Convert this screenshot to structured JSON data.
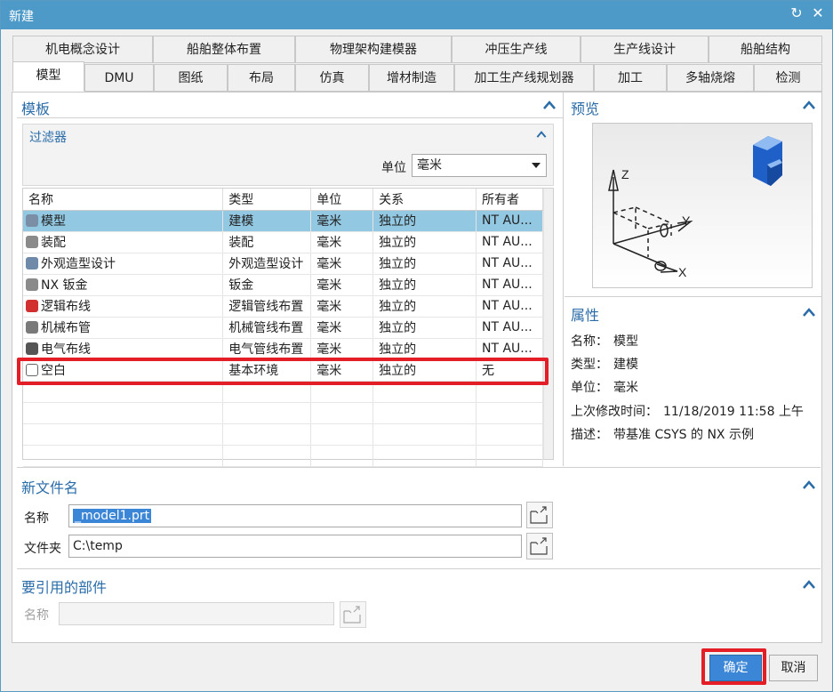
{
  "window": {
    "title": "新建",
    "refresh_glyph": "↻",
    "close_glyph": "✕"
  },
  "tabs_row1": [
    "机电概念设计",
    "船舶整体布置",
    "物理架构建模器",
    "冲压生产线",
    "生产线设计",
    "船舶结构"
  ],
  "tabs_row2": [
    "模型",
    "DMU",
    "图纸",
    "布局",
    "仿真",
    "增材制造",
    "加工生产线规划器",
    "加工",
    "多轴烧熔",
    "检测"
  ],
  "template": {
    "title": "模板",
    "filter": {
      "title": "过滤器",
      "unit_label": "单位",
      "unit_value": "毫米"
    },
    "columns": [
      "名称",
      "类型",
      "单位",
      "关系",
      "所有者"
    ],
    "rows": [
      {
        "name": "模型",
        "type": "建模",
        "unit": "毫米",
        "relation": "独立的",
        "owner": "NT AU...",
        "icon": "model-icon",
        "selected": true
      },
      {
        "name": "装配",
        "type": "装配",
        "unit": "毫米",
        "relation": "独立的",
        "owner": "NT AU...",
        "icon": "assembly-icon"
      },
      {
        "name": "外观造型设计",
        "type": "外观造型设计",
        "unit": "毫米",
        "relation": "独立的",
        "owner": "NT AU...",
        "icon": "shape-design-icon"
      },
      {
        "name": "NX 钣金",
        "type": "钣金",
        "unit": "毫米",
        "relation": "独立的",
        "owner": "NT AU...",
        "icon": "sheet-metal-icon"
      },
      {
        "name": "逻辑布线",
        "type": "逻辑管线布置",
        "unit": "毫米",
        "relation": "独立的",
        "owner": "NT AU...",
        "icon": "logic-routing-icon"
      },
      {
        "name": "机械布管",
        "type": "机械管线布置",
        "unit": "毫米",
        "relation": "独立的",
        "owner": "NT AU...",
        "icon": "mech-piping-icon"
      },
      {
        "name": "电气布线",
        "type": "电气管线布置",
        "unit": "毫米",
        "relation": "独立的",
        "owner": "NT AU...",
        "icon": "electrical-routing-icon"
      },
      {
        "name": "空白",
        "type": "基本环境",
        "unit": "毫米",
        "relation": "独立的",
        "owner": "无",
        "icon": "blank-icon"
      }
    ]
  },
  "preview": {
    "title": "预览",
    "axis_x": "X",
    "axis_y": "Y",
    "axis_z": "Z"
  },
  "properties": {
    "title": "属性",
    "name_label": "名称：",
    "name_value": "模型",
    "type_label": "类型：",
    "type_value": "建模",
    "unit_label": "单位：",
    "unit_value": "毫米",
    "modified_label": "上次修改时间：",
    "modified_value": "11/18/2019 11:58 上午",
    "desc_label": "描述：",
    "desc_value": "带基准 CSYS 的 NX 示例"
  },
  "new_file": {
    "title": "新文件名",
    "name_label": "名称",
    "name_value": "_model1.prt",
    "folder_label": "文件夹",
    "folder_value": "C:\\temp"
  },
  "ref_part": {
    "title": "要引用的部件",
    "name_label": "名称",
    "name_value": ""
  },
  "buttons": {
    "ok": "确定",
    "cancel": "取消"
  }
}
